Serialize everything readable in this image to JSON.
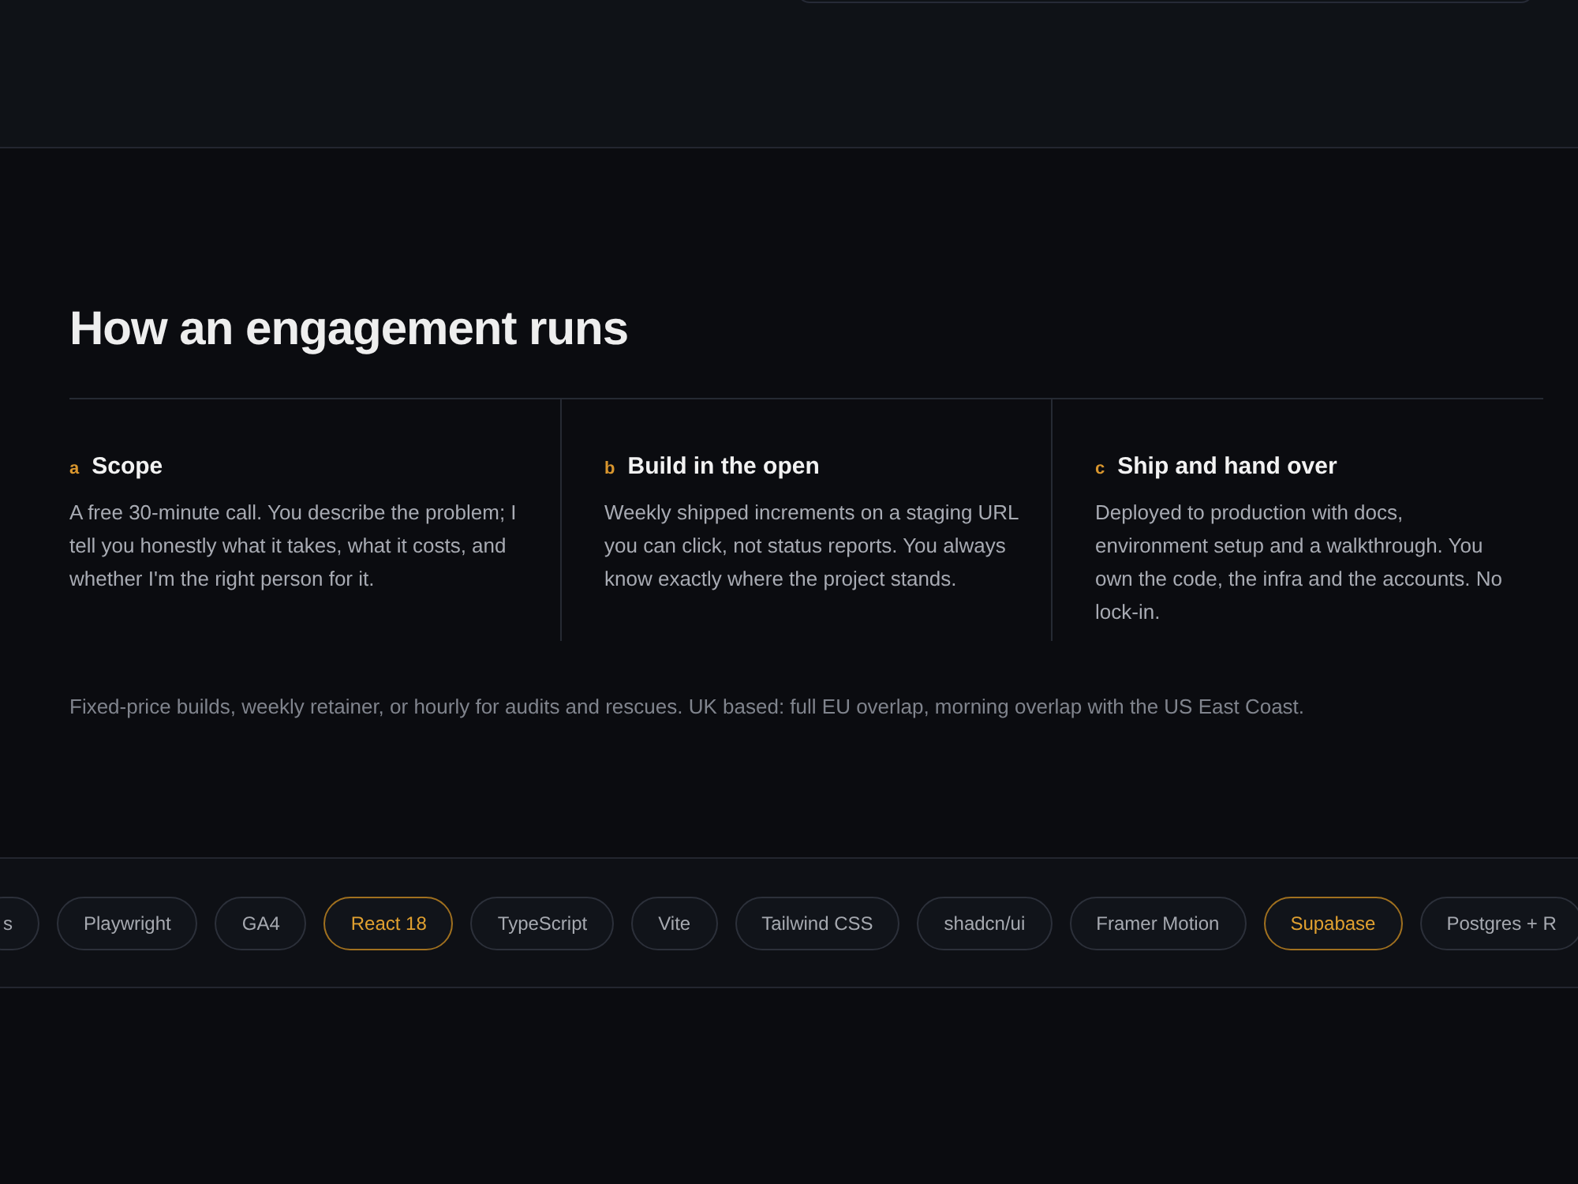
{
  "section": {
    "title": "How an engagement runs",
    "steps": [
      {
        "marker": "a",
        "title": "Scope",
        "text": "A free 30-minute call. You describe the problem; I tell you honestly what it takes, what it costs, and whether I'm the right person for it."
      },
      {
        "marker": "b",
        "title": "Build in the open",
        "text": "Weekly shipped increments on a staging URL you can click, not status reports. You always know exactly where the project stands."
      },
      {
        "marker": "c",
        "title": "Ship and hand over",
        "text": "Deployed to production with docs, environment setup and a walkthrough. You own the code, the infra and the accounts. No lock-in."
      }
    ],
    "note": "Fixed-price builds, weekly retainer, or hourly for audits and rescues. UK based: full EU overlap, morning overlap with the US East Coast."
  },
  "tech_chips": [
    {
      "label": "s",
      "highlighted": false
    },
    {
      "label": "Playwright",
      "highlighted": false
    },
    {
      "label": "GA4",
      "highlighted": false
    },
    {
      "label": "React 18",
      "highlighted": true
    },
    {
      "label": "TypeScript",
      "highlighted": false
    },
    {
      "label": "Vite",
      "highlighted": false
    },
    {
      "label": "Tailwind CSS",
      "highlighted": false
    },
    {
      "label": "shadcn/ui",
      "highlighted": false
    },
    {
      "label": "Framer Motion",
      "highlighted": false
    },
    {
      "label": "Supabase",
      "highlighted": true
    },
    {
      "label": "Postgres + R",
      "highlighted": false
    }
  ]
}
